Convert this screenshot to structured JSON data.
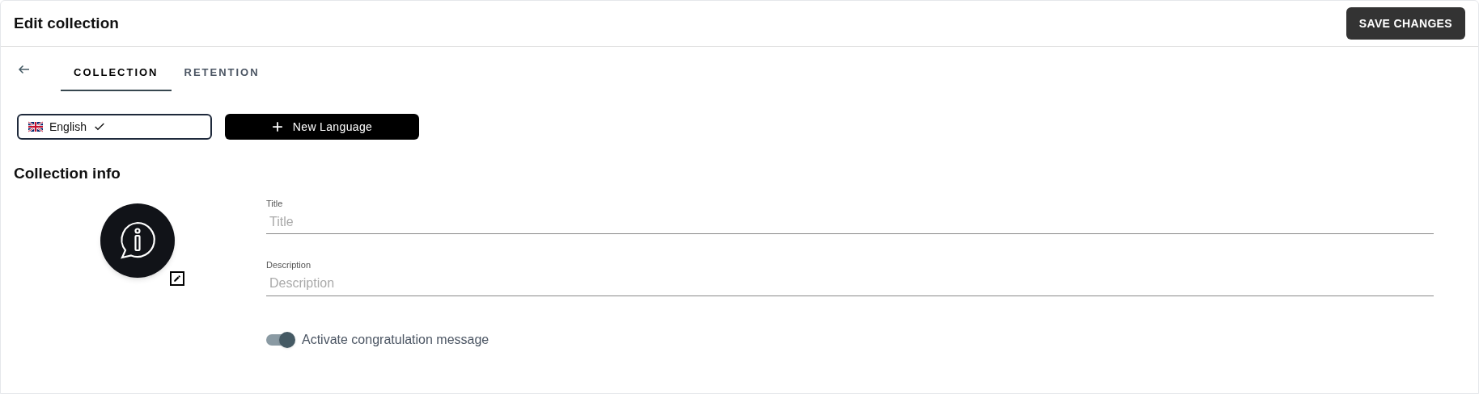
{
  "header": {
    "title": "Edit collection",
    "save_button": "SAVE CHANGES"
  },
  "tabs": [
    {
      "label": "COLLECTION",
      "selected": true
    },
    {
      "label": "RETENTION",
      "selected": false
    }
  ],
  "languages": [
    {
      "label": "English",
      "selected": true
    }
  ],
  "new_language_button": "New Language",
  "section_title": "Collection info",
  "fields": [
    {
      "label": "Title",
      "placeholder": "Title"
    },
    {
      "label": "Description",
      "placeholder": "Description"
    }
  ],
  "toggle": {
    "label": "Activate congratulation message",
    "on": true
  }
}
